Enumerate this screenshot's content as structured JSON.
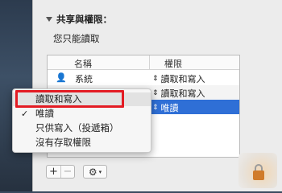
{
  "section": {
    "title": "共享與權限：",
    "subtitle": "您只能讀取"
  },
  "table": {
    "columns": [
      "名稱",
      "權限"
    ],
    "rows": [
      {
        "name": "系統",
        "permission": "讀取和寫入",
        "icon": "user-icon",
        "selected": false
      },
      {
        "name": "",
        "permission": "讀取和寫入",
        "icon": "",
        "selected": false
      },
      {
        "name": "",
        "permission": "唯讀",
        "icon": "",
        "selected": true
      }
    ]
  },
  "popup_menu": {
    "items": [
      {
        "label": "讀取和寫入",
        "checked": false,
        "highlighted": true
      },
      {
        "label": "唯讀",
        "checked": true,
        "highlighted": false
      },
      {
        "label": "只供寫入（投遞箱）",
        "checked": false,
        "highlighted": false
      },
      {
        "label": "沒有存取權限",
        "checked": false,
        "highlighted": false
      }
    ],
    "check_mark": "✓"
  },
  "toolbar": {
    "add_label": "+",
    "remove_label": "−",
    "gear_glyph": "⚙",
    "chevron_glyph": "▾"
  },
  "colors": {
    "selection": "#2f6fd6",
    "annotation": "#e31b23"
  }
}
